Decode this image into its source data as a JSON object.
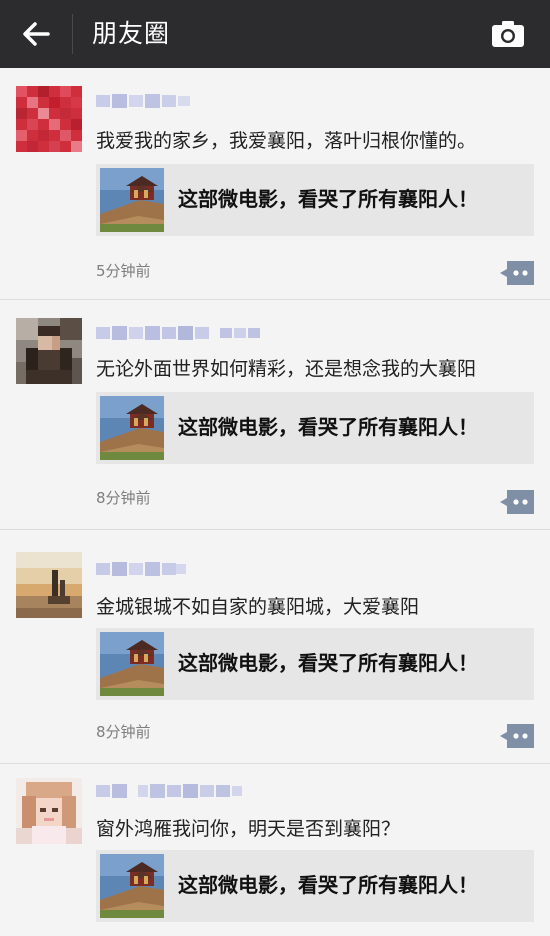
{
  "header": {
    "title": "朋友圈",
    "back_icon": "arrow-left-icon",
    "camera_icon": "camera-icon"
  },
  "posts": [
    {
      "text": "我爱我的家乡，我爱襄阳，落叶归根你懂的。",
      "share_title": "这部微电影，看哭了所有襄阳人！",
      "time": "5分钟前"
    },
    {
      "text": "无论外面世界如何精彩，还是想念我的大襄阳",
      "share_title": "这部微电影，看哭了所有襄阳人！",
      "time": "8分钟前"
    },
    {
      "text": "金城银城不如自家的襄阳城，大爱襄阳",
      "share_title": "这部微电影，看哭了所有襄阳人！",
      "time": "8分钟前"
    },
    {
      "text": "窗外鸿雁我问你，明天是否到襄阳？",
      "share_title": "这部微电影，看哭了所有襄阳人！"
    }
  ],
  "colors": {
    "header_bg": "#2c2c2e",
    "comment_button": "#7f8fa6",
    "share_card_bg": "#e6e6e6"
  }
}
